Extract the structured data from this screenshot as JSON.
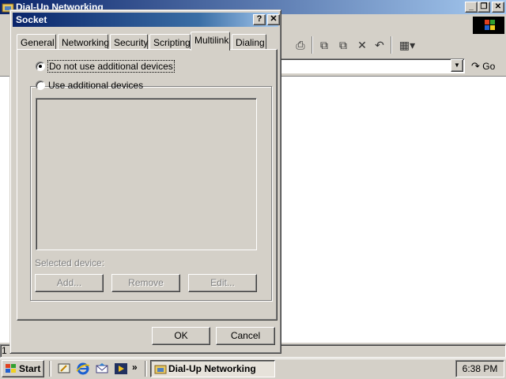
{
  "background_window": {
    "title": "Dial-Up Networking",
    "status_text": "1",
    "go_label": "Go"
  },
  "dialog": {
    "title": "Socket",
    "help_button": "?",
    "close_button": "✕",
    "tabs": [
      {
        "label": "General",
        "active": false
      },
      {
        "label": "Networking",
        "active": false
      },
      {
        "label": "Security",
        "active": false
      },
      {
        "label": "Scripting",
        "active": false
      },
      {
        "label": "Multilink",
        "active": true
      },
      {
        "label": "Dialing",
        "active": false
      }
    ],
    "multilink": {
      "option_no_additional": "Do not use additional devices",
      "option_use_additional": "Use additional devices",
      "selected_option": "Do not use additional devices",
      "selected_device_label": "Selected device:",
      "add_button": "Add...",
      "remove_button": "Remove",
      "edit_button": "Edit..."
    },
    "ok_button": "OK",
    "cancel_button": "Cancel"
  },
  "taskbar": {
    "start_label": "Start",
    "chevron": "»",
    "task_button": "Dial-Up Networking",
    "clock": "6:38 PM"
  },
  "colors": {
    "title_active": "#0a246a",
    "face": "#d4d0c8",
    "window_bg": "#ffffff"
  }
}
